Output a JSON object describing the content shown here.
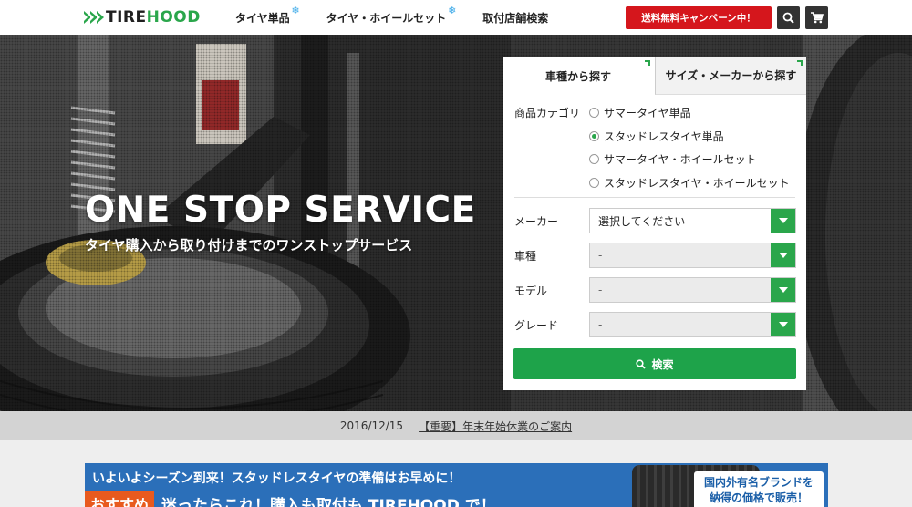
{
  "header": {
    "logo": {
      "part1": "TIRE",
      "part2": "HOOD"
    },
    "nav": [
      {
        "label": "タイヤ単品",
        "badge": "❄"
      },
      {
        "label": "タイヤ・ホイールセット",
        "badge": "❄"
      },
      {
        "label": "取付店舗検索"
      }
    ],
    "campaign_button": "送料無料キャンペーン中！",
    "icons": [
      "search-icon",
      "cart-icon"
    ]
  },
  "hero": {
    "title": "ONE STOP SERVICE",
    "subtitle": "タイヤ購入から取り付けまでのワンストップサービス"
  },
  "search_panel": {
    "tabs": [
      {
        "label": "車種から探す",
        "active": true
      },
      {
        "label": "サイズ・メーカーから探す",
        "active": false
      }
    ],
    "category_label": "商品カテゴリ",
    "categories": [
      {
        "label": "サマータイヤ単品",
        "selected": false
      },
      {
        "label": "スタッドレスタイヤ単品",
        "selected": true
      },
      {
        "label": "サマータイヤ・ホイールセット",
        "selected": false
      },
      {
        "label": "スタッドレスタイヤ・ホイールセット",
        "selected": false
      }
    ],
    "fields": [
      {
        "label": "メーカー",
        "value": "選択してください",
        "enabled": true
      },
      {
        "label": "車種",
        "value": "-",
        "enabled": false
      },
      {
        "label": "モデル",
        "value": "-",
        "enabled": false
      },
      {
        "label": "グレード",
        "value": "-",
        "enabled": false
      }
    ],
    "search_button": "検索"
  },
  "news": {
    "date": "2016/12/15",
    "title": "【重要】年末年始休業のご案内"
  },
  "banner": {
    "line1": "いよいよシーズン到来！スタッドレスタイヤの準備はお早めに！",
    "tag": "おすすめ",
    "line2": "迷ったらこれ！購入も取付も TIREHOOD で！",
    "brand_text_1": "国内外有名ブランドを",
    "brand_text_2": "納得の価格で販売！"
  },
  "colors": {
    "brand_green": "#2aa64b",
    "campaign_red": "#d5161c",
    "banner_blue": "#2b6fb9",
    "snow_blue": "#38a8e8"
  }
}
